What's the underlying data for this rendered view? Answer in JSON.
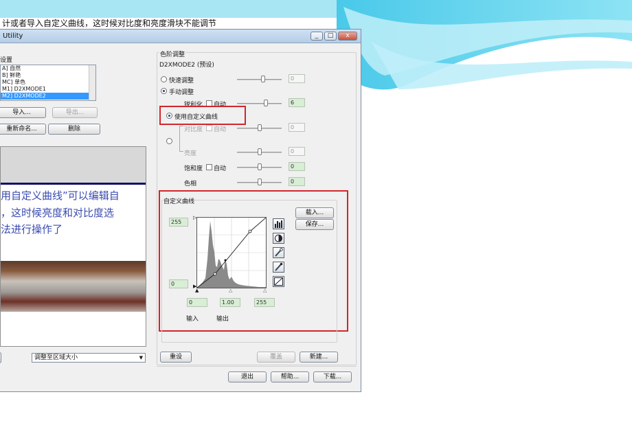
{
  "caption": "计或者导入自定义曲线，这时候对比度和亮度滑块不能调节",
  "window": {
    "title": "Utility",
    "controls": [
      "_",
      "□",
      "x"
    ]
  },
  "left": {
    "settings_label": "设置",
    "list_items": [
      "A] 自然",
      "B] 鲜艳",
      "MC] 单色",
      "M1] D2XMODE1",
      "M2] D2XMODE2"
    ],
    "selected_index": 4,
    "import_button": "导入...",
    "export_button": "导出...",
    "rename_button": "重新命名...",
    "delete_button": "删除",
    "preview_overlay": [
      "用自定义曲线”可以编辑自",
      "，这时候亮度和对比度选",
      "法进行操作了"
    ],
    "fit_select": "调整至区域大小"
  },
  "right": {
    "group_label": "色阶调整",
    "preset_name": "D2XMODE2 (预设)",
    "quick_adjust": {
      "label": "快速调整",
      "value": "0"
    },
    "manual_adjust": {
      "label": "手动调整"
    },
    "sharpening": {
      "label": "锐利化",
      "auto": "自动",
      "value": "6"
    },
    "custom_curve_radio": "使用自定义曲线",
    "contrast": {
      "label": "对比度",
      "auto": "自动",
      "value": "0"
    },
    "brightness": {
      "label": "亮度",
      "value": "0"
    },
    "saturation": {
      "label": "饱和度",
      "auto": "自动",
      "value": "0"
    },
    "hue": {
      "label": "色相",
      "value": "0"
    }
  },
  "curve": {
    "group_label": "自定义曲线",
    "output_high": "255",
    "output_low": "0",
    "input_low": "0",
    "gamma": "1.00",
    "input_high": "255",
    "input_label": "输入",
    "output_label": "输出",
    "load_button": "载入...",
    "save_button": "保存..."
  },
  "footer": {
    "reset_button": "重设",
    "overwrite_button": "覆盖",
    "new_button": "新建...",
    "exit_button": "退出",
    "help_button": "帮助...",
    "download_button": "下载..."
  },
  "colors": {
    "highlight_box": "#d0262b",
    "value_box": "#d8eed5",
    "selection": "#3399ff"
  },
  "icons": [
    "histogram-icon",
    "contrast-icon",
    "white-eyedropper-icon",
    "black-eyedropper-icon",
    "reset-curve-icon"
  ]
}
